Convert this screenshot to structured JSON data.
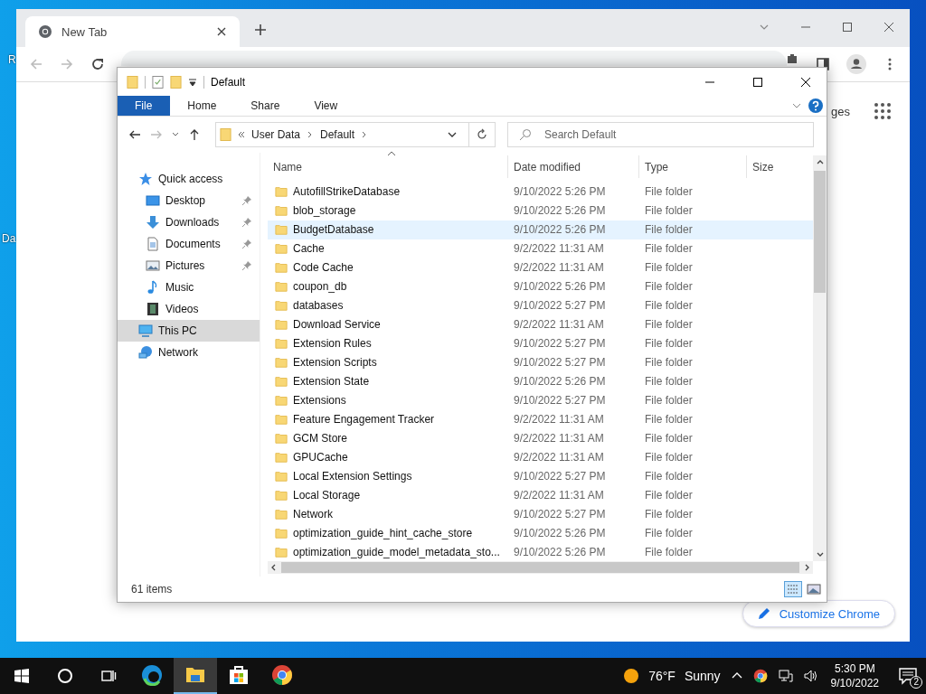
{
  "desktop_labels": [
    "R",
    "Da"
  ],
  "browser": {
    "tab": {
      "title": "New Tab",
      "selected": true
    },
    "partial_link": "ges",
    "customize_button": "Customize Chrome"
  },
  "explorer": {
    "title": "Default",
    "ribbon_tabs": [
      {
        "label": "File",
        "selected": true
      },
      {
        "label": "Home",
        "selected": false
      },
      {
        "label": "Share",
        "selected": false
      },
      {
        "label": "View",
        "selected": false
      }
    ],
    "breadcrumb": [
      "User Data",
      "Default"
    ],
    "search_placeholder": "Search Default",
    "sidebar": [
      {
        "label": "Quick access",
        "kind": "star",
        "selected": false,
        "children": [
          {
            "label": "Desktop",
            "kind": "desktop",
            "pinned": true,
            "selected": false
          },
          {
            "label": "Downloads",
            "kind": "download",
            "pinned": true,
            "selected": false
          },
          {
            "label": "Documents",
            "kind": "document",
            "pinned": true,
            "selected": false
          },
          {
            "label": "Pictures",
            "kind": "pictures",
            "pinned": true,
            "selected": false
          },
          {
            "label": "Music",
            "kind": "music",
            "pinned": false,
            "selected": false
          },
          {
            "label": "Videos",
            "kind": "video",
            "pinned": false,
            "selected": false
          }
        ]
      },
      {
        "label": "This PC",
        "kind": "pc",
        "selected": true
      },
      {
        "label": "Network",
        "kind": "network",
        "selected": false
      }
    ],
    "columns": [
      "Name",
      "Date modified",
      "Type",
      "Size"
    ],
    "rows": [
      {
        "name": "AutofillStrikeDatabase",
        "date": "9/10/2022 5:26 PM",
        "type": "File folder",
        "highlighted": false
      },
      {
        "name": "blob_storage",
        "date": "9/10/2022 5:26 PM",
        "type": "File folder",
        "highlighted": false
      },
      {
        "name": "BudgetDatabase",
        "date": "9/10/2022 5:26 PM",
        "type": "File folder",
        "highlighted": true
      },
      {
        "name": "Cache",
        "date": "9/2/2022 11:31 AM",
        "type": "File folder",
        "highlighted": false
      },
      {
        "name": "Code Cache",
        "date": "9/2/2022 11:31 AM",
        "type": "File folder",
        "highlighted": false
      },
      {
        "name": "coupon_db",
        "date": "9/10/2022 5:26 PM",
        "type": "File folder",
        "highlighted": false
      },
      {
        "name": "databases",
        "date": "9/10/2022 5:27 PM",
        "type": "File folder",
        "highlighted": false
      },
      {
        "name": "Download Service",
        "date": "9/2/2022 11:31 AM",
        "type": "File folder",
        "highlighted": false
      },
      {
        "name": "Extension Rules",
        "date": "9/10/2022 5:27 PM",
        "type": "File folder",
        "highlighted": false
      },
      {
        "name": "Extension Scripts",
        "date": "9/10/2022 5:27 PM",
        "type": "File folder",
        "highlighted": false
      },
      {
        "name": "Extension State",
        "date": "9/10/2022 5:26 PM",
        "type": "File folder",
        "highlighted": false
      },
      {
        "name": "Extensions",
        "date": "9/10/2022 5:27 PM",
        "type": "File folder",
        "highlighted": false
      },
      {
        "name": "Feature Engagement Tracker",
        "date": "9/2/2022 11:31 AM",
        "type": "File folder",
        "highlighted": false
      },
      {
        "name": "GCM Store",
        "date": "9/2/2022 11:31 AM",
        "type": "File folder",
        "highlighted": false
      },
      {
        "name": "GPUCache",
        "date": "9/2/2022 11:31 AM",
        "type": "File folder",
        "highlighted": false
      },
      {
        "name": "Local Extension Settings",
        "date": "9/10/2022 5:27 PM",
        "type": "File folder",
        "highlighted": false
      },
      {
        "name": "Local Storage",
        "date": "9/2/2022 11:31 AM",
        "type": "File folder",
        "highlighted": false
      },
      {
        "name": "Network",
        "date": "9/10/2022 5:27 PM",
        "type": "File folder",
        "highlighted": false
      },
      {
        "name": "optimization_guide_hint_cache_store",
        "date": "9/10/2022 5:26 PM",
        "type": "File folder",
        "highlighted": false
      },
      {
        "name": "optimization_guide_model_metadata_sto...",
        "date": "9/10/2022 5:26 PM",
        "type": "File folder",
        "highlighted": false
      }
    ],
    "status": "61 items"
  },
  "taskbar": {
    "apps": [
      {
        "kind": "edge",
        "active": false
      },
      {
        "kind": "explorer",
        "active": true
      },
      {
        "kind": "store",
        "active": false
      },
      {
        "kind": "chrome",
        "active": false
      }
    ],
    "weather_temp": "76°F",
    "weather_text": "Sunny",
    "time": "5:30 PM",
    "date": "9/10/2022",
    "notifications": "2"
  }
}
